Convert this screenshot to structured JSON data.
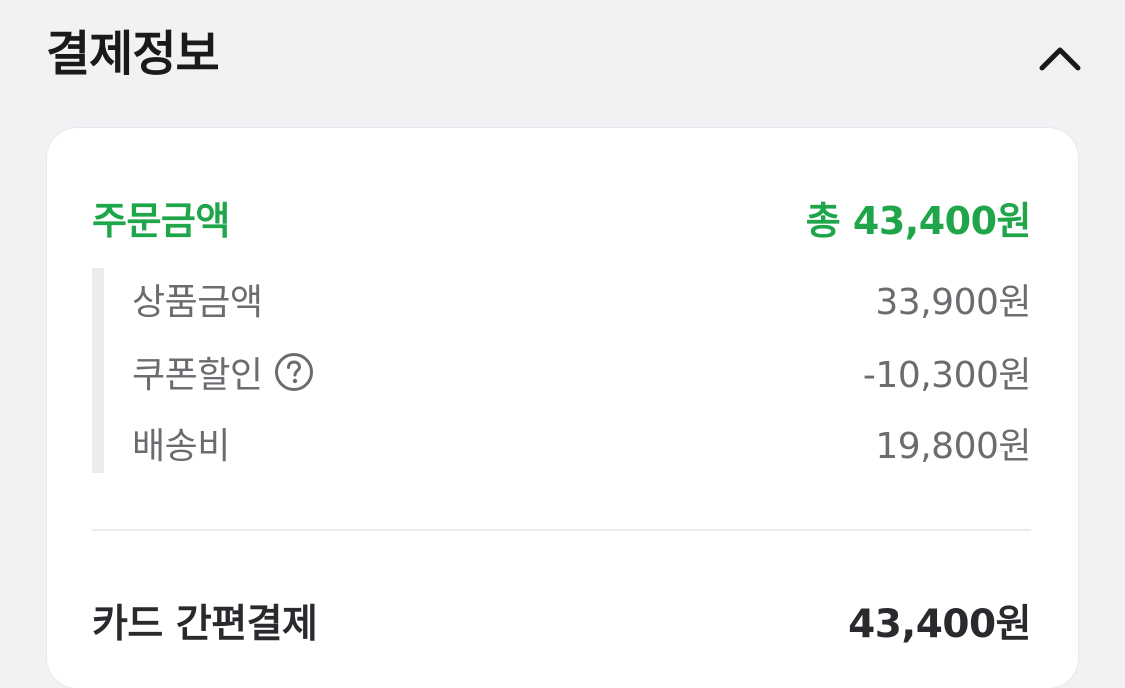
{
  "header": {
    "title": "결제정보",
    "collapse_icon": "chevron-up-icon"
  },
  "colors": {
    "accent_green": "#1fa54a",
    "page_background": "#f1f2f4",
    "card_background": "#ffffff",
    "muted_text": "#6b6b70"
  },
  "order": {
    "label": "주문금액",
    "total": "총 43,400원"
  },
  "breakdown": [
    {
      "label": "상품금액",
      "amount": "33,900원"
    },
    {
      "label": "쿠폰할인",
      "amount": "-10,300원",
      "help_icon": "question-circle-icon"
    },
    {
      "label": "배송비",
      "amount": "19,800원"
    }
  ],
  "payment": {
    "method": "카드 간편결제",
    "amount": "43,400원"
  }
}
